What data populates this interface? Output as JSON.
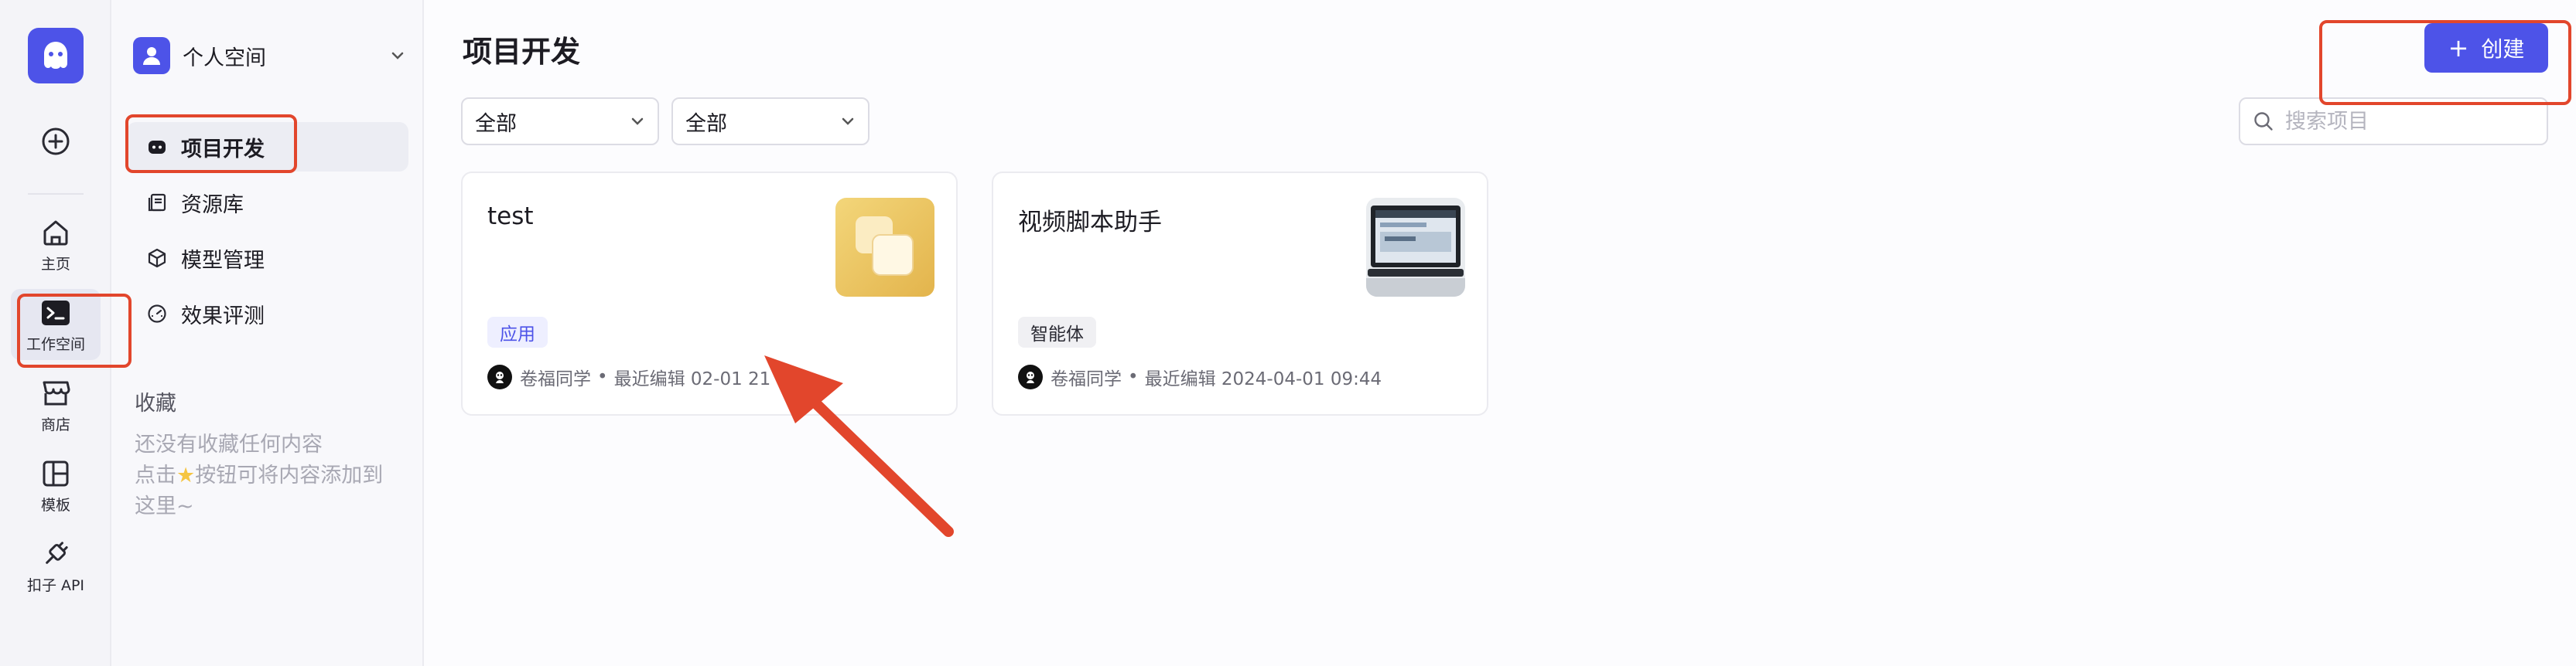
{
  "rail": {
    "items": [
      {
        "label": "主页",
        "icon": "home-icon"
      },
      {
        "label": "工作空间",
        "icon": "terminal-icon"
      },
      {
        "label": "商店",
        "icon": "store-icon"
      },
      {
        "label": "模板",
        "icon": "template-icon"
      },
      {
        "label": "扣子 API",
        "icon": "plug-icon"
      }
    ]
  },
  "sidebar": {
    "space_name": "个人空间",
    "nav": [
      {
        "label": "项目开发",
        "icon": "bot-icon"
      },
      {
        "label": "资源库",
        "icon": "library-icon"
      },
      {
        "label": "模型管理",
        "icon": "cube-icon"
      },
      {
        "label": "效果评测",
        "icon": "gauge-icon"
      }
    ],
    "favorites_title": "收藏",
    "favorites_empty_line1": "还没有收藏任何内容",
    "favorites_empty_line2_a": "点击",
    "favorites_empty_line2_b": "按钮可将内容添加到",
    "favorites_empty_line3": "这里~"
  },
  "main": {
    "title": "项目开发",
    "create_label": "创建",
    "filter1": "全部",
    "filter2": "全部",
    "search_placeholder": "搜索项目"
  },
  "cards": [
    {
      "title": "test",
      "tag": "应用",
      "author": "卷福同学",
      "edited": "最近编辑 02-01 21"
    },
    {
      "title": "视频脚本助手",
      "tag": "智能体",
      "author": "卷福同学",
      "edited": "最近编辑 2024-04-01 09:44"
    }
  ],
  "colors": {
    "brand": "#4d53e8",
    "annotation": "#e2462c",
    "app_tag_bg": "#eeefff",
    "app_tag_fg": "#4d53e8",
    "agent_tag_bg": "#f0f0f3",
    "agent_tag_fg": "#2a2a33"
  }
}
